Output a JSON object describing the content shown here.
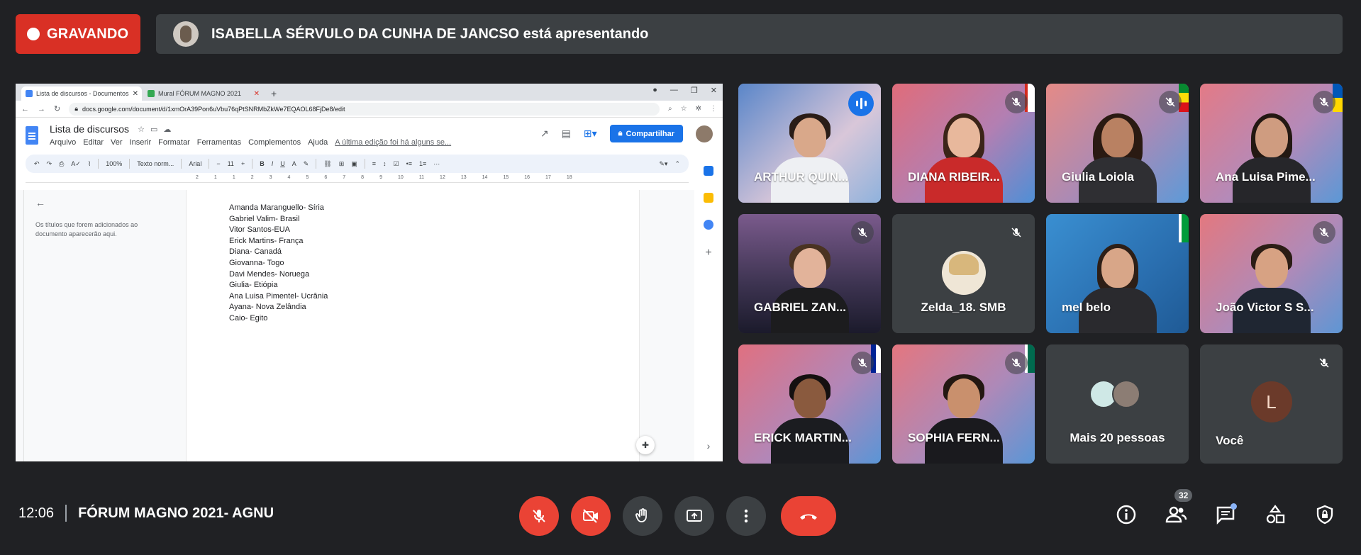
{
  "recording": {
    "label": "GRAVANDO"
  },
  "presenter_bar": {
    "text": "ISABELLA SÉRVULO DA CUNHA DE JANCSO está apresentando"
  },
  "shared_screen": {
    "browser_tabs": [
      {
        "label": "Lista de discursos - Documentos",
        "active": true,
        "color": "#4285f4"
      },
      {
        "label": "Mural FÓRUM MAGNO 2021",
        "active": false,
        "color": "#34a853"
      }
    ],
    "address": "docs.google.com/document/d/1xmOrA39Pon6uVbu76qPtSNRMbZkWe7EQAOL68FjDe8/edit",
    "doc_title": "Lista de discursos",
    "menu": [
      "Arquivo",
      "Editar",
      "Ver",
      "Inserir",
      "Formatar",
      "Ferramentas",
      "Complementos",
      "Ajuda"
    ],
    "last_edit": "A última edição foi há alguns se...",
    "share_button": "Compartilhar",
    "toolbar": {
      "zoom": "100%",
      "style": "Texto norm...",
      "font": "Arial",
      "size": "11"
    },
    "ruler_ticks": [
      "2",
      "1",
      "1",
      "2",
      "3",
      "4",
      "5",
      "6",
      "7",
      "8",
      "9",
      "10",
      "11",
      "12",
      "13",
      "14",
      "15",
      "16",
      "17",
      "18"
    ],
    "outline_hint": "Os títulos que forem adicionados ao documento aparecerão aqui.",
    "doc_lines": [
      "Amanda Maranguello- Síria",
      "Gabriel Valim- Brasil",
      "Vitor Santos-EUA",
      "Erick Martins- França",
      "Diana- Canadá",
      "Giovanna- Togo",
      "Davi Mendes- Noruega",
      "Giulia- Etiópia",
      "Ana Luisa Pimentel- Ucrânia",
      "Ayana- Nova Zelândia",
      "Caio- Egito"
    ]
  },
  "participants": [
    {
      "name": "ARTHUR QUIN...",
      "state": "speaking"
    },
    {
      "name": "DIANA RIBEIR...",
      "state": "muted"
    },
    {
      "name": "Giulia Loiola",
      "state": "muted"
    },
    {
      "name": "Ana Luisa Pime...",
      "state": "muted"
    },
    {
      "name": "GABRIEL ZAN...",
      "state": "muted"
    },
    {
      "name": "Zelda_18. SMB",
      "state": "muted"
    },
    {
      "name": "mel belo",
      "state": "none"
    },
    {
      "name": "João Victor S S...",
      "state": "muted"
    },
    {
      "name": "ERICK MARTIN...",
      "state": "muted"
    },
    {
      "name": "SOPHIA FERN...",
      "state": "muted"
    },
    {
      "name": "Mais 20 pessoas",
      "state": "none"
    },
    {
      "name": "Você",
      "state": "muted",
      "avatar_letter": "L"
    }
  ],
  "bottom_bar": {
    "time": "12:06",
    "meeting_name": "FÓRUM MAGNO 2021- AGNU",
    "participant_count": "32"
  },
  "colors": {
    "hangup": "#ea4335",
    "recording": "#d93025",
    "accent": "#8ab4f8",
    "bar": "#3c4043"
  }
}
